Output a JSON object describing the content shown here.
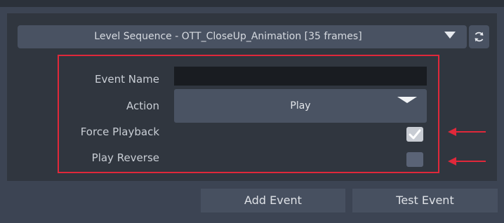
{
  "sequence": {
    "label": "Level Sequence - OTT_CloseUp_Animation [35 frames]",
    "dropdown_icon": "caret-down-icon",
    "refresh_icon": "refresh-icon"
  },
  "form": {
    "event_name": {
      "label": "Event Name",
      "value": ""
    },
    "action": {
      "label": "Action",
      "value": "Play"
    },
    "force_playback": {
      "label": "Force Playback",
      "checked": true
    },
    "play_reverse": {
      "label": "Play Reverse",
      "checked": false
    }
  },
  "annotations": {
    "color": "#e0283a"
  },
  "buttons": {
    "add_event": "Add Event",
    "test_event": "Test Event"
  }
}
